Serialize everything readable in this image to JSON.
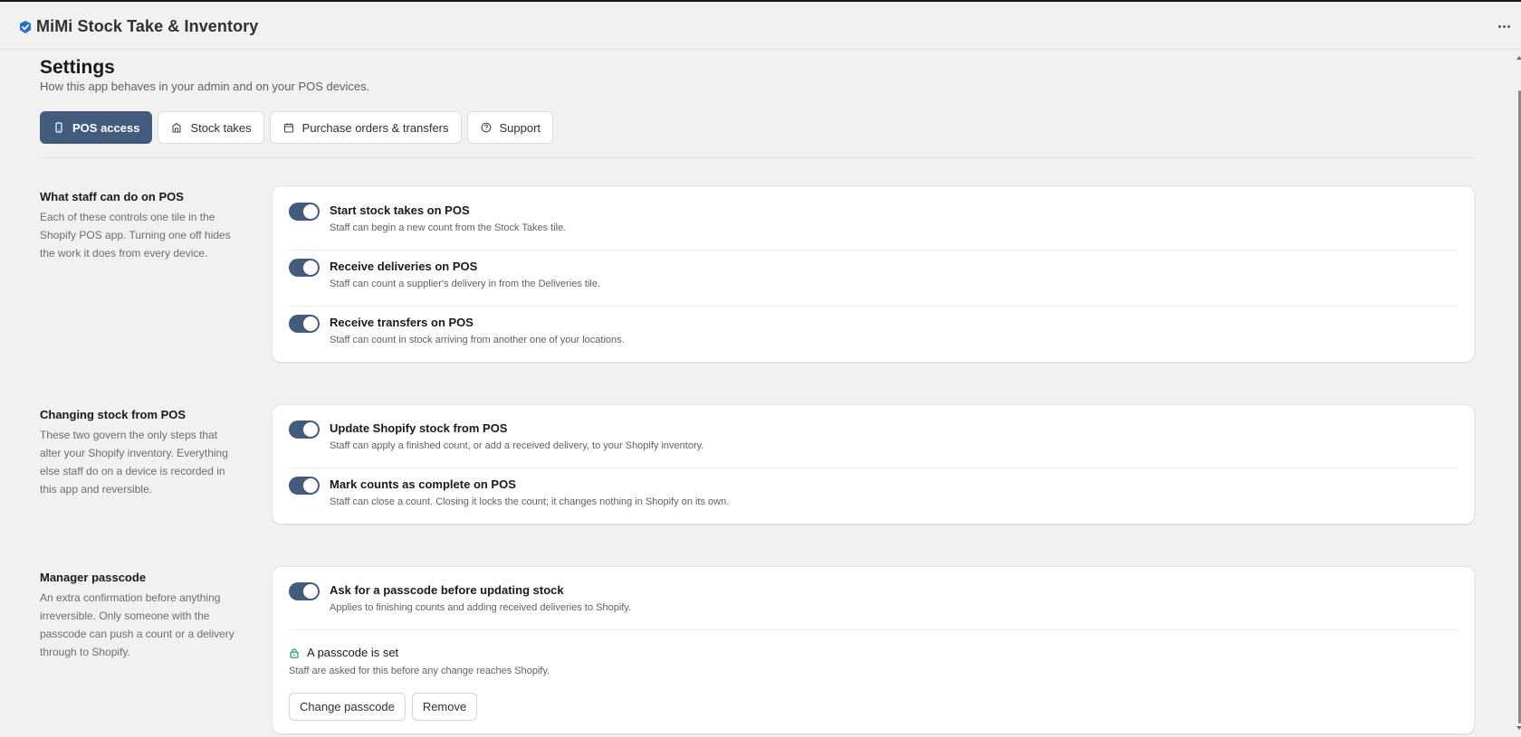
{
  "app": {
    "title": "MiMi Stock Take & Inventory",
    "logo_icon": "cube-check-icon",
    "accent_color": "#2c6ecb"
  },
  "header": {
    "more_icon": "ellipsis-icon"
  },
  "page": {
    "title": "Settings",
    "subtitle": "How this app behaves in your admin and on your POS devices."
  },
  "tabs": [
    {
      "label": "POS access",
      "icon": "mobile-icon",
      "active": true
    },
    {
      "label": "Stock takes",
      "icon": "clipboard-icon",
      "active": false
    },
    {
      "label": "Purchase orders & transfers",
      "icon": "calendar-icon",
      "active": false
    },
    {
      "label": "Support",
      "icon": "question-circle-icon",
      "active": false
    }
  ],
  "sections": [
    {
      "heading": "What staff can do on POS",
      "description": "Each of these controls one tile in the Shopify POS app. Turning one off hides the work it does from every device.",
      "settings": [
        {
          "title": "Start stock takes on POS",
          "description": "Staff can begin a new count from the Stock Takes tile.",
          "enabled": true
        },
        {
          "title": "Receive deliveries on POS",
          "description": "Staff can count a supplier's delivery in from the Deliveries tile.",
          "enabled": true
        },
        {
          "title": "Receive transfers on POS",
          "description": "Staff can count in stock arriving from another one of your locations.",
          "enabled": true
        }
      ]
    },
    {
      "heading": "Changing stock from POS",
      "description": "These two govern the only steps that alter your Shopify inventory. Everything else staff do on a device is recorded in this app and reversible.",
      "settings": [
        {
          "title": "Update Shopify stock from POS",
          "description": "Staff can apply a finished count, or add a received delivery, to your Shopify inventory.",
          "enabled": true
        },
        {
          "title": "Mark counts as complete on POS",
          "description": "Staff can close a count. Closing it locks the count; it changes nothing in Shopify on its own.",
          "enabled": true
        }
      ]
    },
    {
      "heading": "Manager passcode",
      "description": "An extra confirmation before anything irreversible. Only someone with the passcode can push a count or a delivery through to Shopify.",
      "settings": [
        {
          "title": "Ask for a passcode before updating stock",
          "description": "Applies to finishing counts and adding received deliveries to Shopify.",
          "enabled": true
        }
      ],
      "passcode": {
        "status_icon": "lock-icon",
        "status_color": "#1a8d5f",
        "status_label": "A passcode is set",
        "note": "Staff are asked for this before any change reaches Shopify.",
        "change_label": "Change passcode",
        "remove_label": "Remove"
      }
    }
  ],
  "colors": {
    "toggle_on": "#435b7d",
    "active_tab": "#435b7d"
  }
}
